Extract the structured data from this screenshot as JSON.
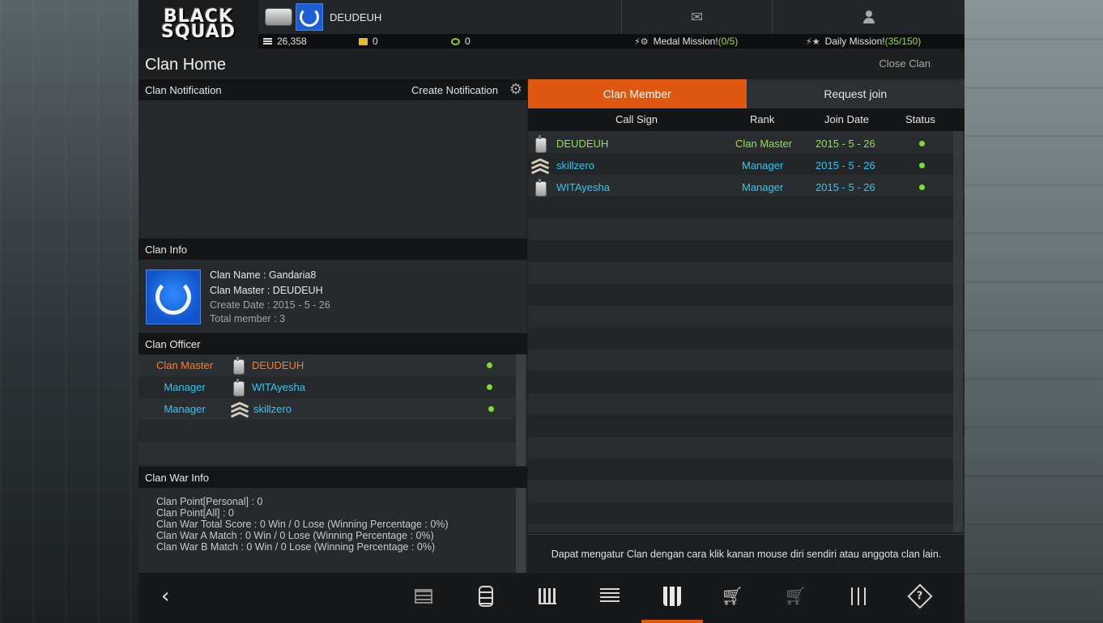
{
  "topbar": {
    "logo_line1": "BLACK",
    "logo_line2": "SQUAD",
    "player_name": "DEUDEUH",
    "points": "26,358",
    "cards": "0",
    "coins": "0",
    "medal_mission_label": "Medal Mission!",
    "medal_mission_progress": "(0/5)",
    "daily_mission_label": "Daily Mission!",
    "daily_mission_progress": "(35/150)",
    "icons": [
      "mail-icon",
      "user-icon",
      "rank-badge-icon",
      "clan-emblem-icon"
    ]
  },
  "page": {
    "title": "Clan Home",
    "close_label": "Close Clan"
  },
  "notification": {
    "header": "Clan Notification",
    "create_label": "Create Notification"
  },
  "clan_info": {
    "header": "Clan Info",
    "name_line": "Clan Name : Gandaria8",
    "master_line": "Clan Master : DEUDEUH",
    "date_line": "Create Date : 2015 - 5 - 26",
    "members_line": "Total member : 3"
  },
  "officers": {
    "header": "Clan Officer",
    "rows": [
      {
        "role": "Clan Master",
        "name": "DEUDEUH",
        "rank_icon": "dogtag-icon",
        "online": true
      },
      {
        "role": "Manager",
        "name": "WITAyesha",
        "rank_icon": "dogtag-icon",
        "online": true
      },
      {
        "role": "Manager",
        "name": "skillzero",
        "rank_icon": "chevron-rank-icon",
        "online": true
      }
    ]
  },
  "war_info": {
    "header": "Clan War Info",
    "lines": [
      "Clan Point[Personal] : 0",
      "Clan Point[All] : 0",
      "Clan War Total Score : 0 Win / 0 Lose (Winning Percentage : 0%)",
      "Clan War A Match : 0 Win / 0 Lose (Winning Percentage : 0%)",
      "Clan War B Match : 0 Win / 0 Lose (Winning Percentage : 0%)"
    ]
  },
  "tabs": [
    {
      "label": "Clan Member",
      "active": true
    },
    {
      "label": "Request join",
      "active": false
    }
  ],
  "members": {
    "columns": [
      "Call Sign",
      "Rank",
      "Join Date",
      "Status"
    ],
    "rows": [
      {
        "call_sign": "DEUDEUH",
        "rank": "Clan Master",
        "join_date": "2015 - 5 - 26",
        "rank_icon": "dogtag-icon",
        "online": true
      },
      {
        "call_sign": "skillzero",
        "rank": "Manager",
        "join_date": "2015 - 5 - 26",
        "rank_icon": "chevron-rank-icon",
        "online": true
      },
      {
        "call_sign": "WITAyesha",
        "rank": "Manager",
        "join_date": "2015 - 5 - 26",
        "rank_icon": "dogtag-icon",
        "online": true
      }
    ]
  },
  "hint": "Dapat mengatur Clan dengan cara klik kanan mouse diri sendiri atau anggota clan lain.",
  "bottom_nav": {
    "items": [
      "back-icon",
      "list-icon",
      "backpack-icon",
      "stats-icon",
      "board-icon",
      "clan-icon",
      "shop-icon",
      "cart-icon",
      "settings-icon",
      "help-icon"
    ],
    "active": "clan-icon"
  },
  "colors": {
    "accent": "#e0580f",
    "online": "#7de02a",
    "master_text": "#8fe24b",
    "manager_text": "#33c7f0",
    "officer_master_role": "#ff7a1e"
  }
}
